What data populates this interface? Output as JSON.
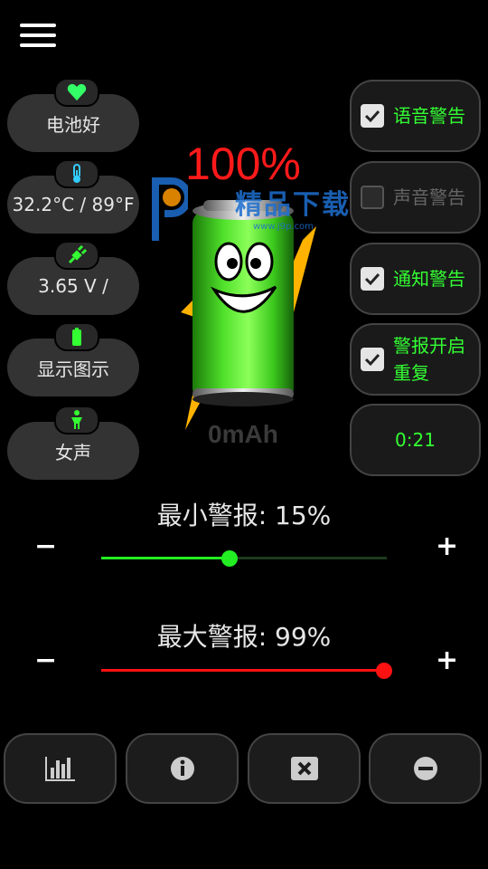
{
  "menu": {
    "icon": "hamburger-menu-icon"
  },
  "left_panel": [
    {
      "label": "电池好",
      "icon": "heart-icon",
      "color": "#33ff66"
    },
    {
      "label": "32.2°C / 89°F",
      "icon": "thermometer-icon",
      "color": "#33ccff"
    },
    {
      "label": "3.65 V /",
      "icon": "plug-icon",
      "color": "#33ff33"
    },
    {
      "label": "显示图示",
      "icon": "battery-icon",
      "color": "#33ff33"
    },
    {
      "label": "女声",
      "icon": "person-icon",
      "color": "#33ff33"
    }
  ],
  "battery": {
    "percent": "100%",
    "capacity": "0mAh",
    "percent_color": "#ff1a1a"
  },
  "watermark": {
    "text": "精品下载",
    "url": "www.j9p.com"
  },
  "right_panel": [
    {
      "label": "语音警告",
      "checked": true
    },
    {
      "label": "声音警告",
      "checked": false
    },
    {
      "label": "通知警告",
      "checked": true
    },
    {
      "label_line1": "警报开启",
      "label_line2": "重复",
      "checked": true
    },
    {
      "label": "0:21"
    }
  ],
  "min_alarm": {
    "label": "最小警报: 15%",
    "value_percent": 15,
    "minus": "−",
    "plus": "+",
    "color": "#22ee22"
  },
  "max_alarm": {
    "label": "最大警报: 99%",
    "value_percent": 99,
    "minus": "−",
    "plus": "+",
    "color": "#ff1111"
  },
  "bottom_bar": [
    {
      "icon": "bar-chart-icon"
    },
    {
      "icon": "info-icon"
    },
    {
      "icon": "close-box-icon"
    },
    {
      "icon": "minus-circle-icon"
    }
  ]
}
